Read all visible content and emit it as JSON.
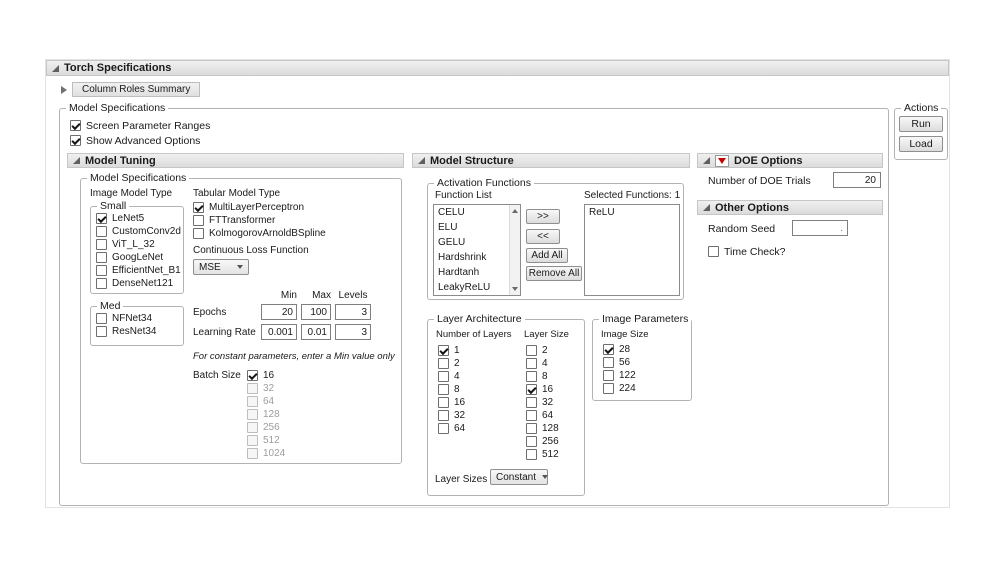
{
  "window": {
    "title": "Torch Specifications",
    "column_roles_label": "Column Roles Summary"
  },
  "actions": {
    "title": "Actions",
    "run": "Run",
    "load": "Load"
  },
  "model_specifications": {
    "title": "Model Specifications",
    "options": [
      {
        "label": "Screen Parameter Ranges",
        "checked": true
      },
      {
        "label": "Show Advanced Options",
        "checked": true
      }
    ]
  },
  "model_tuning": {
    "title": "Model Tuning",
    "box_title": "Model Specifications",
    "image_model_type_label": "Image Model Type",
    "small_group": {
      "title": "Small",
      "items": [
        {
          "label": "LeNet5",
          "checked": true
        },
        {
          "label": "CustomConv2d",
          "checked": false
        },
        {
          "label": "ViT_L_32",
          "checked": false
        },
        {
          "label": "GoogLeNet",
          "checked": false
        },
        {
          "label": "EfficientNet_B1",
          "checked": false
        },
        {
          "label": "DenseNet121",
          "checked": false
        }
      ]
    },
    "med_group": {
      "title": "Med",
      "items": [
        {
          "label": "NFNet34",
          "checked": false
        },
        {
          "label": "ResNet34",
          "checked": false
        }
      ]
    },
    "tabular_label": "Tabular Model Type",
    "tabular_items": [
      {
        "label": "MultiLayerPerceptron",
        "checked": true
      },
      {
        "label": "FTTransformer",
        "checked": false
      },
      {
        "label": "KolmogorovArnoldBSpline",
        "checked": false
      }
    ],
    "loss_label": "Continuous Loss Function",
    "loss_value": "MSE",
    "params_table": {
      "headers": [
        "Min",
        "Max",
        "Levels"
      ],
      "rows": [
        {
          "label": "Epochs",
          "min": "20",
          "max": "100",
          "levels": "3"
        },
        {
          "label": "Learning Rate",
          "min": "0.001",
          "max": "0.01",
          "levels": "3"
        }
      ]
    },
    "constant_note": "For constant parameters, enter a Min value only",
    "batch_size_label": "Batch Size",
    "batch_sizes": [
      {
        "label": "16",
        "checked": true,
        "disabled": false
      },
      {
        "label": "32",
        "checked": false,
        "disabled": true
      },
      {
        "label": "64",
        "checked": false,
        "disabled": true
      },
      {
        "label": "128",
        "checked": false,
        "disabled": true
      },
      {
        "label": "256",
        "checked": false,
        "disabled": true
      },
      {
        "label": "512",
        "checked": false,
        "disabled": true
      },
      {
        "label": "1024",
        "checked": false,
        "disabled": true
      }
    ]
  },
  "model_structure": {
    "title": "Model Structure",
    "activation": {
      "title": "Activation Functions",
      "function_list_label": "Function List",
      "functions": [
        "CELU",
        "ELU",
        "GELU",
        "Hardshrink",
        "Hardtanh",
        "LeakyReLU"
      ],
      "add_button": ">>",
      "remove_button": "<<",
      "add_all_button": "Add All",
      "remove_all_button": "Remove All",
      "selected_label": "Selected Functions: 1",
      "selected_functions": [
        "ReLU"
      ]
    },
    "layer_architecture": {
      "title": "Layer Architecture",
      "num_layers_label": "Number of Layers",
      "num_layers": [
        {
          "label": "1",
          "checked": true
        },
        {
          "label": "2",
          "checked": false
        },
        {
          "label": "4",
          "checked": false
        },
        {
          "label": "8",
          "checked": false
        },
        {
          "label": "16",
          "checked": false
        },
        {
          "label": "32",
          "checked": false
        },
        {
          "label": "64",
          "checked": false
        }
      ],
      "layer_size_label": "Layer Size",
      "layer_size_options": [
        {
          "label": "2",
          "checked": false
        },
        {
          "label": "4",
          "checked": false
        },
        {
          "label": "8",
          "checked": false
        },
        {
          "label": "16",
          "checked": true
        },
        {
          "label": "32",
          "checked": false
        },
        {
          "label": "64",
          "checked": false
        },
        {
          "label": "128",
          "checked": false
        },
        {
          "label": "256",
          "checked": false
        },
        {
          "label": "512",
          "checked": false
        }
      ],
      "layer_sizes_label": "Layer Sizes",
      "layer_sizes_value": "Constant"
    },
    "image_parameters": {
      "title": "Image Parameters",
      "image_size_label": "Image Size",
      "sizes": [
        {
          "label": "28",
          "checked": true
        },
        {
          "label": "56",
          "checked": false
        },
        {
          "label": "122",
          "checked": false
        },
        {
          "label": "224",
          "checked": false
        }
      ]
    }
  },
  "doe_options": {
    "title": "DOE Options",
    "trials_label": "Number of DOE Trials",
    "trials_value": "20"
  },
  "other_options": {
    "title": "Other Options",
    "random_seed_label": "Random Seed",
    "random_seed_value": ".",
    "time_check": {
      "label": "Time Check?",
      "checked": false
    }
  },
  "colors": {
    "accent_red": "#cc0000",
    "header_bg": "#e4e4e4",
    "group_border": "#b3b3b3"
  }
}
